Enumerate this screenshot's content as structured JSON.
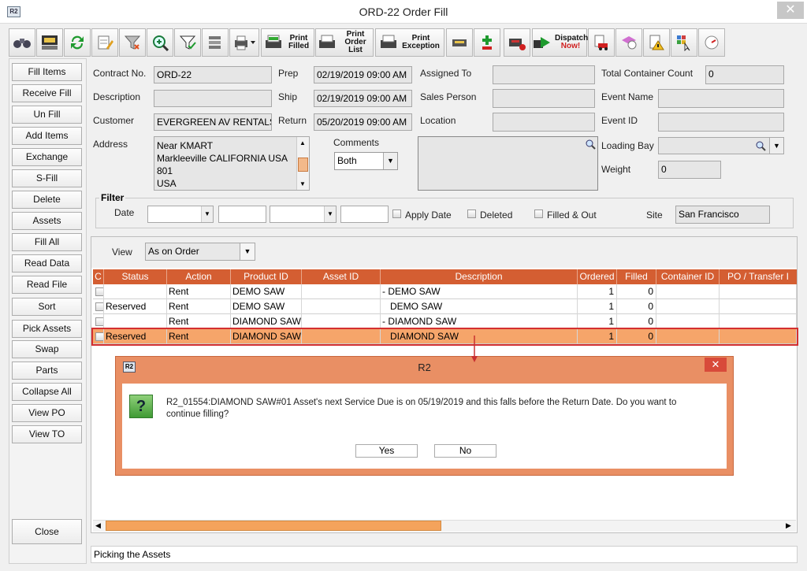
{
  "window": {
    "title": "ORD-22 Order Fill",
    "icon": "R2",
    "close": "✕"
  },
  "toolbar": {
    "print_filled": "Print Filled",
    "print_order_list": "Print Order List",
    "print_exception": "Print Exception",
    "dispatch_now_a": "Dispatch",
    "dispatch_now_b": "Now!"
  },
  "sidebar": [
    "Fill Items",
    "Receive Fill",
    "Un Fill",
    "Add Items",
    "Exchange",
    "S-Fill",
    "Delete",
    "Assets",
    "Fill  All",
    "Read Data",
    "Read File",
    "Sort",
    "Pick Assets",
    "Swap",
    "Parts",
    "Collapse All",
    "View PO",
    "View TO"
  ],
  "close_label": "Close",
  "form": {
    "contract_no_label": "Contract No.",
    "contract_no": "ORD-22",
    "description_label": "Description",
    "description": "",
    "customer_label": "Customer",
    "customer": "EVERGREEN AV RENTALS",
    "address_label": "Address",
    "address_lines": [
      "Near KMART",
      "Markleeville CALIFORNIA USA",
      "801",
      "USA"
    ],
    "prep_label": "Prep",
    "prep": "02/19/2019 09:00 AM",
    "ship_label": "Ship",
    "ship": "02/19/2019 09:00 AM",
    "return_label": "Return",
    "return": "05/20/2019 09:00 AM",
    "assigned_to_label": "Assigned To",
    "assigned_to": "",
    "sales_person_label": "Sales Person",
    "sales_person": "",
    "location_label": "Location",
    "location": "",
    "comments_label": "Comments",
    "comments_select": "Both",
    "total_container_label": "Total Container Count",
    "total_container": "0",
    "event_name_label": "Event Name",
    "event_name": "",
    "event_id_label": "Event ID",
    "event_id": "",
    "loading_bay_label": "Loading Bay",
    "loading_bay": "",
    "weight_label": "Weight",
    "weight": "0"
  },
  "filter": {
    "title": "Filter",
    "date_label": "Date",
    "apply_date": "Apply Date",
    "deleted": "Deleted",
    "filled_out": "Filled & Out",
    "site_label": "Site",
    "site": "San Francisco"
  },
  "view": {
    "label": "View",
    "value": "As on Order"
  },
  "grid": {
    "columns": [
      "C",
      "Status",
      "Action",
      "Product ID",
      "Asset ID",
      "Description",
      "Ordered",
      "Filled",
      "Container ID",
      "PO / Transfer I"
    ],
    "rows": [
      {
        "status": "",
        "action": "Rent",
        "product": "DEMO SAW",
        "asset": "",
        "desc": "- DEMO SAW",
        "ordered": "1",
        "filled": "0"
      },
      {
        "status": "Reserved",
        "action": "Rent",
        "product": "DEMO SAW",
        "asset": "",
        "desc": "   DEMO SAW",
        "ordered": "1",
        "filled": "0"
      },
      {
        "status": "",
        "action": "Rent",
        "product": "DIAMOND SAW",
        "asset": "",
        "desc": "- DIAMOND SAW",
        "ordered": "1",
        "filled": "0"
      },
      {
        "status": "Reserved",
        "action": "Rent",
        "product": "DIAMOND SAW",
        "asset": "",
        "desc": "   DIAMOND SAW",
        "ordered": "1",
        "filled": "0"
      }
    ]
  },
  "dialog": {
    "title": "R2",
    "icon": "R2",
    "question_glyph": "?",
    "message_1": "R2_01554:DIAMOND SAW#01 Asset's next Service Due is on 05/19/2019 and this falls before the Return Date. Do you want to",
    "message_2": "continue filling?",
    "yes": "Yes",
    "no": "No"
  },
  "status_bar": "Picking the Assets"
}
